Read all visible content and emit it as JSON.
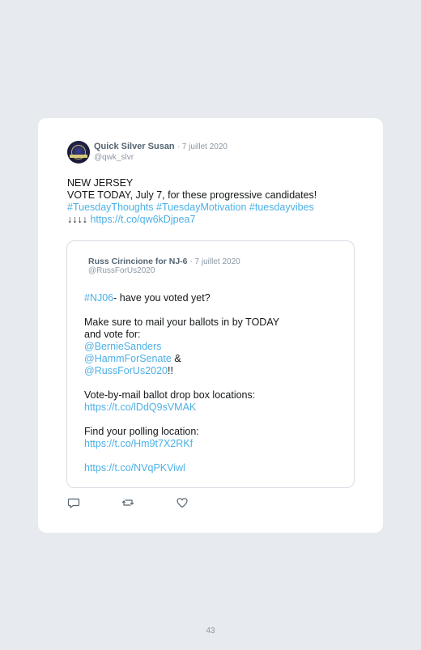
{
  "tweet": {
    "author_name": "Quick Silver Susan",
    "date": "· 7 juillet 2020",
    "handle": "@qwk_slvr",
    "lines": [
      {
        "text": "NEW JERSEY"
      },
      {
        "text": "VOTE TODAY, July 7, for these progressive candidates!"
      }
    ],
    "hashtags": "#TuesdayThoughts #TuesdayMotivation #tuesdayvibes",
    "arrows": "↓↓↓↓",
    "link": "https://t.co/qw6kDjpea7"
  },
  "quoted_tweet": {
    "author_name": "Russ Cirincione for NJ-6",
    "date": "· 7 juillet 2020",
    "handle": "@RussForUs2020",
    "hashtag": "#NJ06",
    "line1_rest": "- have you voted yet?",
    "line2": "Make sure to mail your ballots in by TODAY",
    "line3": "and vote for:",
    "mention1": "@BernieSanders",
    "mention2": "@HammForSenate",
    "amp": " &",
    "mention3": "@RussForUs2020",
    "bang": "!!",
    "dropbox_label": "Vote-by-mail ballot drop box locations:",
    "dropbox_link": "https://t.co/lDdQ9sVMAK",
    "polling_label": "Find your polling location:",
    "polling_link": "https://t.co/Hm9t7X2RKf",
    "last_link": "https://t.co/NVqPKViwl"
  },
  "icons": {
    "reply": "reply-icon",
    "retweet": "retweet-icon",
    "like": "heart-icon",
    "color": "#536471"
  },
  "page_number": "43"
}
